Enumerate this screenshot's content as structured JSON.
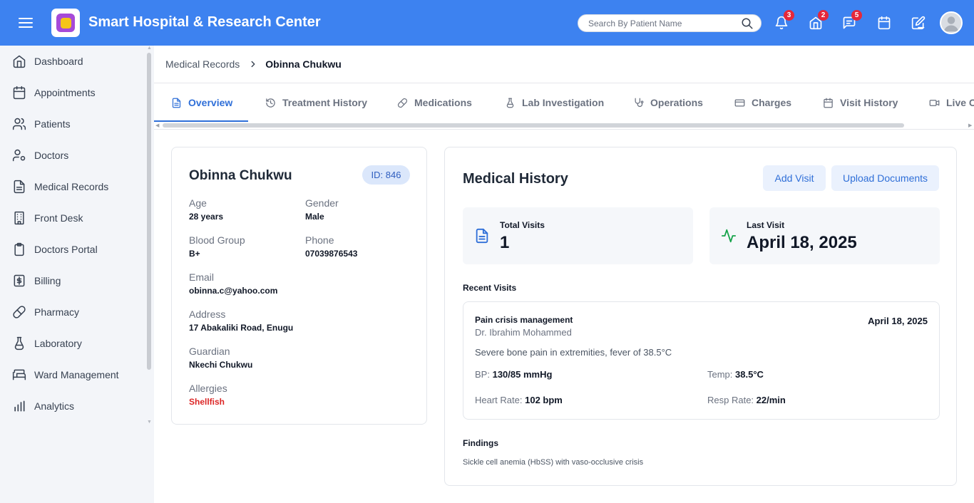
{
  "app": {
    "title": "Smart Hospital & Research Center",
    "accent_color": "#3d82f0",
    "search_placeholder": "Search By Patient Name"
  },
  "topbar": {
    "icons": [
      {
        "name": "bell-icon",
        "badge": "3"
      },
      {
        "name": "home-icon",
        "badge": "2"
      },
      {
        "name": "chat-icon",
        "badge": "5"
      },
      {
        "name": "calendar-icon",
        "badge": ""
      },
      {
        "name": "edit-icon",
        "badge": ""
      }
    ],
    "avatar_alt": "User"
  },
  "sidebar": {
    "items": [
      {
        "label": "Dashboard",
        "icon": "home-icon"
      },
      {
        "label": "Appointments",
        "icon": "calendar-icon"
      },
      {
        "label": "Patients",
        "icon": "users-icon"
      },
      {
        "label": "Doctors",
        "icon": "user-gear-icon"
      },
      {
        "label": "Medical Records",
        "icon": "file-icon"
      },
      {
        "label": "Front Desk",
        "icon": "building-icon"
      },
      {
        "label": "Doctors Portal",
        "icon": "clipboard-icon"
      },
      {
        "label": "Billing",
        "icon": "dollar-icon"
      },
      {
        "label": "Pharmacy",
        "icon": "pill-icon"
      },
      {
        "label": "Laboratory",
        "icon": "flask-icon"
      },
      {
        "label": "Ward Management",
        "icon": "bed-icon"
      },
      {
        "label": "Analytics",
        "icon": "chart-icon"
      }
    ]
  },
  "breadcrumb": {
    "parent": "Medical Records",
    "current": "Obinna Chukwu"
  },
  "tabs": [
    {
      "label": "Overview",
      "icon": "document-icon",
      "active": true
    },
    {
      "label": "Treatment History",
      "icon": "history-icon",
      "active": false
    },
    {
      "label": "Medications",
      "icon": "pill-icon",
      "active": false
    },
    {
      "label": "Lab Investigation",
      "icon": "flask-icon",
      "active": false
    },
    {
      "label": "Operations",
      "icon": "stethoscope-icon",
      "active": false
    },
    {
      "label": "Charges",
      "icon": "card-icon",
      "active": false
    },
    {
      "label": "Visit History",
      "icon": "calendar-icon",
      "active": false
    },
    {
      "label": "Live Co",
      "icon": "video-icon",
      "active": false
    }
  ],
  "patient": {
    "name": "Obinna Chukwu",
    "id_label": "ID: 846",
    "age_label": "Age",
    "age": "28 years",
    "gender_label": "Gender",
    "gender": "Male",
    "blood_label": "Blood Group",
    "blood": "B+",
    "phone_label": "Phone",
    "phone": "07039876543",
    "email_label": "Email",
    "email": "obinna.c@yahoo.com",
    "address_label": "Address",
    "address": "17 Abakaliki Road, Enugu",
    "guardian_label": "Guardian",
    "guardian": "Nkechi Chukwu",
    "allergies_label": "Allergies",
    "allergies": "Shellfish"
  },
  "history": {
    "title": "Medical History",
    "add_visit": "Add Visit",
    "upload": "Upload Documents",
    "total_visits_label": "Total Visits",
    "total_visits": "1",
    "last_visit_label": "Last Visit",
    "last_visit": "April 18, 2025",
    "recent_label": "Recent Visits",
    "visit": {
      "reason": "Pain crisis management",
      "doctor": "Dr. Ibrahim Mohammed",
      "date": "April 18, 2025",
      "description": "Severe bone pain in extremities, fever of 38.5°C",
      "bp_label": "BP:",
      "bp": "130/85 mmHg",
      "temp_label": "Temp:",
      "temp": "38.5°C",
      "hr_label": "Heart Rate:",
      "hr": "102 bpm",
      "rr_label": "Resp Rate:",
      "rr": "22/min"
    },
    "findings_label": "Findings",
    "findings": "Sickle cell anemia (HbSS) with vaso-occlusive crisis"
  }
}
